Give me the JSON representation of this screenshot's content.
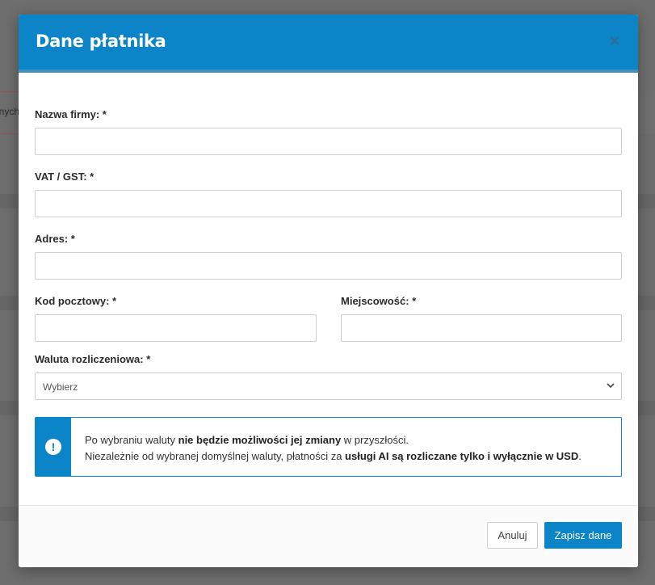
{
  "background": {
    "fragment_text": "nych"
  },
  "modal": {
    "title": "Dane płatnika",
    "close_glyph": "×"
  },
  "form": {
    "company_name": {
      "label": "Nazwa firmy: *",
      "value": "",
      "placeholder": ""
    },
    "vat": {
      "label": "VAT / GST: *",
      "value": "",
      "placeholder": ""
    },
    "address": {
      "label": "Adres: *",
      "value": "",
      "placeholder": ""
    },
    "postal_code": {
      "label": "Kod pocztowy: *",
      "value": "",
      "placeholder": ""
    },
    "city": {
      "label": "Miejscowość: *",
      "value": "",
      "placeholder": ""
    },
    "currency": {
      "label": "Waluta rozliczeniowa: *",
      "selected": "Wybierz"
    }
  },
  "alert": {
    "icon": "exclamation-circle-icon",
    "line1_pre": "Po wybraniu waluty ",
    "line1_bold": "nie będzie możliwości jej zmiany",
    "line1_post": " w przyszłości.",
    "line2_pre": "Niezależnie od wybranej domyślnej waluty, płatności za ",
    "line2_bold": "usługi AI są rozliczane tylko i wyłącznie w USD",
    "line2_post": "."
  },
  "footer": {
    "cancel_label": "Anuluj",
    "save_label": "Zapisz dane"
  },
  "colors": {
    "accent": "#0b84c8",
    "overlay": "#6e6e6e"
  }
}
